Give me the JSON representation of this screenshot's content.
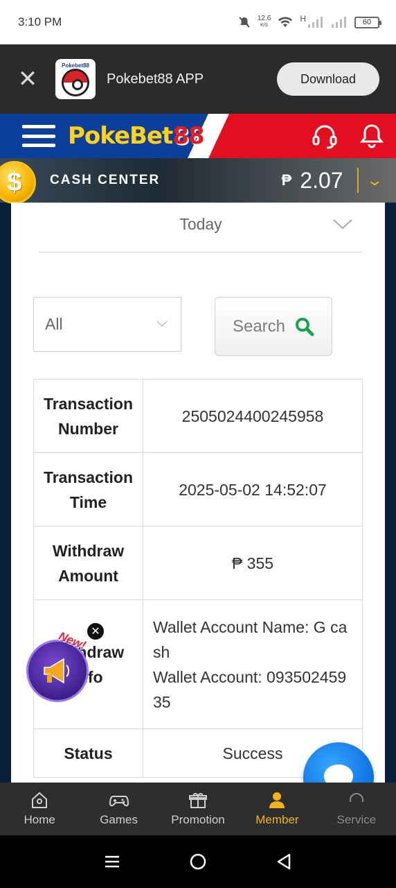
{
  "status_bar": {
    "time": "3:10 PM",
    "net_speed": "12.6",
    "net_unit": "K/S",
    "signal_label": "H",
    "battery": "60"
  },
  "app_banner": {
    "app_name": "Pokebet88 APP",
    "download_label": "Download",
    "logo_text": "Pokebet88"
  },
  "brand_header": {
    "logo_part1": "Poke",
    "logo_part2": "Bet",
    "logo_part3": "88"
  },
  "cash_center": {
    "coin_symbol": "$",
    "label": "CASH CENTER",
    "currency": "₱",
    "balance": "2.07"
  },
  "filters": {
    "date_range": "Today",
    "type": "All",
    "search_label": "Search"
  },
  "transaction": {
    "rows": [
      {
        "label": "Transaction Number",
        "value": "2505024400245958"
      },
      {
        "label": "Transaction Time",
        "value": "2025-05-02 14:52:07"
      },
      {
        "label": "Withdraw Amount",
        "value": "₱ 355"
      },
      {
        "label": "Withdraw Info",
        "value_line1": "Wallet Account Name: G cash",
        "value_line2": "Wallet Account: 09350245935"
      },
      {
        "label": "Status",
        "value": "Success"
      }
    ]
  },
  "promo": {
    "badge": "New!"
  },
  "bottom_nav": {
    "items": [
      {
        "label": "Home",
        "icon": "home-icon"
      },
      {
        "label": "Games",
        "icon": "gamepad-icon"
      },
      {
        "label": "Promotion",
        "icon": "gift-icon"
      },
      {
        "label": "Member",
        "icon": "person-icon"
      },
      {
        "label": "Service",
        "icon": "headset-icon"
      }
    ]
  },
  "colors": {
    "accent": "#f0b41a",
    "brand_blue": "#0b3f9a",
    "brand_red": "#e10f1f",
    "search_icon": "#1aa34a",
    "chat_blue": "#0c6fe0"
  }
}
